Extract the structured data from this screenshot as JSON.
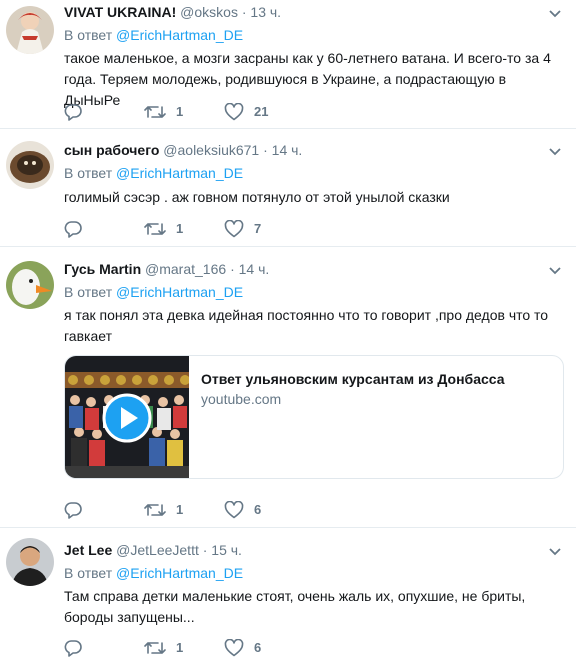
{
  "reply_prefix": "В ответ",
  "tweets": [
    {
      "name": "VIVAT UKRAINA!",
      "handle": "@okskos",
      "time": "13 ч.",
      "mention": "@ErichHartman_DE",
      "text": "такое маленькое, а мозги засраны как у 60-летнего ватана. И всего-то за 4 года. Теряем молодежь, родившуюся в Украине, а подрастающую в ДыНыРе",
      "retweets": "1",
      "likes": "21"
    },
    {
      "name": "сын рабочего",
      "handle": "@aoleksiuk671",
      "time": "14 ч.",
      "mention": "@ErichHartman_DE",
      "text": "голимый сэсэр . аж говном потянуло от этой унылой сказки",
      "retweets": "1",
      "likes": "7"
    },
    {
      "name": "Гусь Martin",
      "handle": "@marat_166",
      "time": "14 ч.",
      "mention": "@ErichHartman_DE",
      "text": "я так понял эта девка идейная постоянно что то говорит ,про дедов что то гавкает",
      "card": {
        "title": "Ответ ульяновским курсантам из Донбасса",
        "domain": "youtube.com"
      },
      "retweets": "1",
      "likes": "6"
    },
    {
      "name": "Jet Lee",
      "handle": "@JetLeeJettt",
      "time": "15 ч.",
      "mention": "@ErichHartman_DE",
      "text": "Там справа детки маленькие стоят, очень жаль их, опухшие, не бриты, бороды запущены...",
      "retweets": "1",
      "likes": "6"
    }
  ],
  "icons": {
    "reply": "reply-icon",
    "retweet": "retweet-icon",
    "like": "heart-icon",
    "more": "chevron-down-icon",
    "play": "play-icon"
  },
  "colors": {
    "link": "#1da1f2",
    "muted": "#657786",
    "text": "#14171a",
    "divider": "#e6ecf0"
  }
}
